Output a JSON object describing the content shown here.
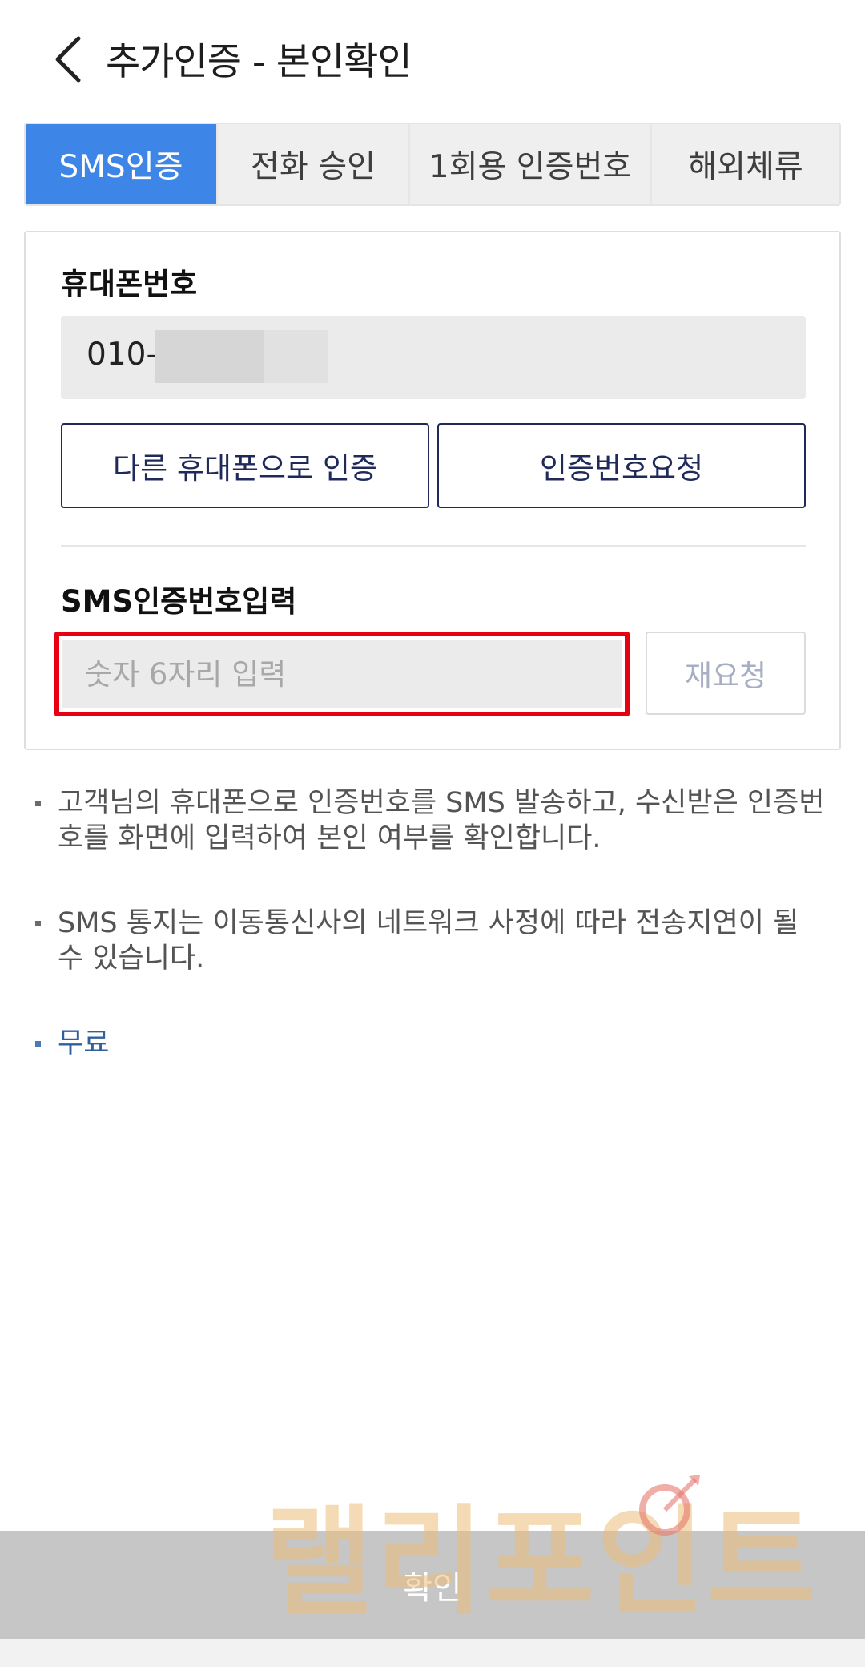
{
  "header": {
    "title": "추가인증 - 본인확인",
    "back_icon": "chevron-left-icon"
  },
  "tabs": [
    {
      "label": "SMS인증",
      "active": true
    },
    {
      "label": "전화 승인",
      "active": false
    },
    {
      "label": "1회용 인증번호",
      "active": false
    },
    {
      "label": "해외체류",
      "active": false
    }
  ],
  "phone": {
    "label": "휴대폰번호",
    "prefix": "010-"
  },
  "buttons": {
    "other_phone": "다른 휴대폰으로 인증",
    "request_code": "인증번호요청",
    "resend": "재요청",
    "confirm": "확인"
  },
  "sms_input": {
    "label": "SMS인증번호입력",
    "placeholder": "숫자 6자리 입력",
    "value": ""
  },
  "notes": [
    "고객님의 휴대폰으로 인증번호를 SMS 발송하고, 수신받은 인증번호를 화면에 입력하여 본인 여부를 확인합니다.",
    "SMS 통지는 이동통신사의 네트워크 사정에 따라 전송지연이 될 수 있습니다.",
    "무료"
  ],
  "watermark": {
    "text": "랠리포인트"
  },
  "colors": {
    "active_tab": "#3d85e6",
    "button_border": "#1f2a5a",
    "highlight_border": "#e60012",
    "confirm_bar": "#c6c6c6",
    "free_note": "#2f5f9c"
  }
}
